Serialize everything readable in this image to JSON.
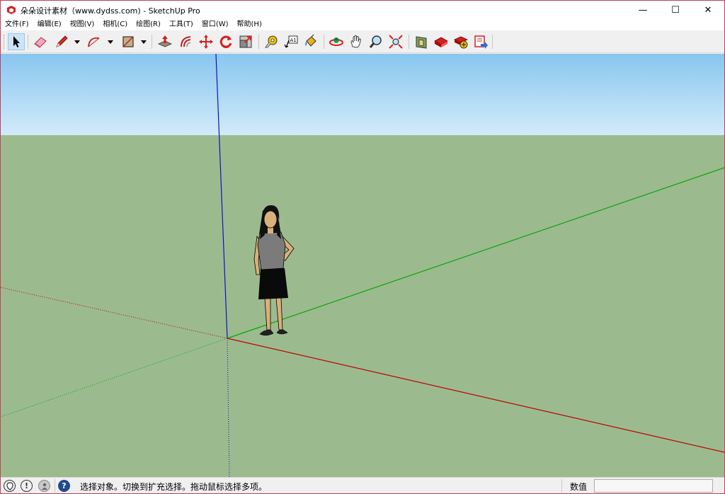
{
  "window": {
    "title": "朵朵设计素材（www.dydss.com) - SketchUp Pro",
    "minimize": "—",
    "maximize": "☐",
    "close": "✕"
  },
  "menubar": [
    {
      "label": "文件(F)"
    },
    {
      "label": "编辑(E)"
    },
    {
      "label": "视图(V)"
    },
    {
      "label": "相机(C)"
    },
    {
      "label": "绘图(R)"
    },
    {
      "label": "工具(T)"
    },
    {
      "label": "窗口(W)"
    },
    {
      "label": "帮助(H)"
    }
  ],
  "toolbar": {
    "tools": [
      "select-tool-icon",
      "eraser-tool-icon",
      "pencil-line-tool-icon",
      "arc-tool-icon",
      "rectangle-tool-icon",
      "push-pull-tool-icon",
      "offset-tool-icon",
      "move-tool-icon",
      "rotate-tool-icon",
      "scale-tool-icon",
      "tape-measure-tool-icon",
      "text-tool-icon",
      "paint-bucket-tool-icon",
      "orbit-tool-icon",
      "pan-tool-icon",
      "zoom-tool-icon",
      "zoom-extents-tool-icon",
      "warehouse-icon",
      "extension-warehouse-icon",
      "share-model-icon",
      "send-to-layout-icon"
    ],
    "active_tool": "select-tool-icon"
  },
  "scene": {
    "sky_color": "#a9d5f2",
    "ground_color": "#9bbb8f",
    "axis_red": "#c00000",
    "axis_green": "#00b000",
    "axis_blue": "#0000cc",
    "figure": "person-figure"
  },
  "statusbar": {
    "icons": [
      "geo-location-icon",
      "credit-info-icon",
      "user-account-icon",
      "help-icon"
    ],
    "text": "选择对象。切换到扩充选择。拖动鼠标选择多项。",
    "measurement_label": "数值",
    "measurement_value": ""
  }
}
